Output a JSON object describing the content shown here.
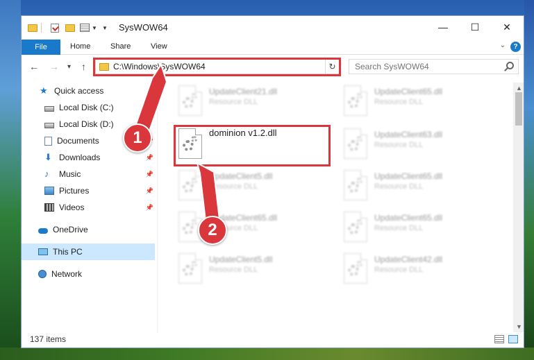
{
  "window": {
    "title": "SysWOW64",
    "minimize_glyph": "—",
    "maximize_glyph": "☐",
    "close_glyph": "✕"
  },
  "ribbon": {
    "file": "File",
    "tabs": [
      "Home",
      "Share",
      "View"
    ],
    "help": "?"
  },
  "navigation": {
    "back": "←",
    "forward": "→",
    "recent": "▾",
    "up": "↑",
    "address": "C:\\Windows\\SysWOW64",
    "refresh": "↻",
    "search_placeholder": "Search SysWOW64"
  },
  "sidebar": {
    "items": [
      {
        "label": "Quick access",
        "icon": "star-icon",
        "pinned": false
      },
      {
        "label": "Local Disk (C:)",
        "icon": "drive-icon",
        "pinned": false
      },
      {
        "label": "Local Disk (D:)",
        "icon": "drive-icon",
        "pinned": true
      },
      {
        "label": "Documents",
        "icon": "documents-icon",
        "pinned": true
      },
      {
        "label": "Downloads",
        "icon": "download-icon",
        "pinned": true
      },
      {
        "label": "Music",
        "icon": "music-icon",
        "pinned": true
      },
      {
        "label": "Pictures",
        "icon": "pictures-icon",
        "pinned": true
      },
      {
        "label": "Videos",
        "icon": "videos-icon",
        "pinned": true
      },
      {
        "label": "OneDrive",
        "icon": "cloud-icon",
        "pinned": false
      },
      {
        "label": "This PC",
        "icon": "computer-icon",
        "pinned": false,
        "selected": true
      },
      {
        "label": "Network",
        "icon": "network-icon",
        "pinned": false
      }
    ]
  },
  "files": [
    {
      "name": "UpdateClient21.dll",
      "type": "Resource DLL",
      "blurred": true
    },
    {
      "name": "UpdateClient65.dll",
      "type": "Resource DLL",
      "blurred": true
    },
    {
      "name": "dominion v1.2.dll",
      "type": "",
      "blurred": false
    },
    {
      "name": "UpdateClient63.dll",
      "type": "Resource DLL",
      "blurred": true
    },
    {
      "name": "UpdateClient5.dll",
      "type": "Resource DLL",
      "blurred": true
    },
    {
      "name": "UpdateClient65.dll",
      "type": "Resource DLL",
      "blurred": true
    },
    {
      "name": "UpdateClient65.dll",
      "type": "Resource DLL",
      "blurred": true
    },
    {
      "name": "UpdateClient65.dll",
      "type": "Resource DLL",
      "blurred": true
    },
    {
      "name": "UpdateClient5.dll",
      "type": "Resource DLL",
      "blurred": true
    },
    {
      "name": "UpdateClient42.dll",
      "type": "Resource DLL",
      "blurred": true
    }
  ],
  "status": {
    "item_count": "137 items"
  },
  "callouts": {
    "one": "1",
    "two": "2"
  },
  "colors": {
    "accent": "#1979ca",
    "highlight": "#d9373b",
    "selected": "#cce8ff"
  }
}
